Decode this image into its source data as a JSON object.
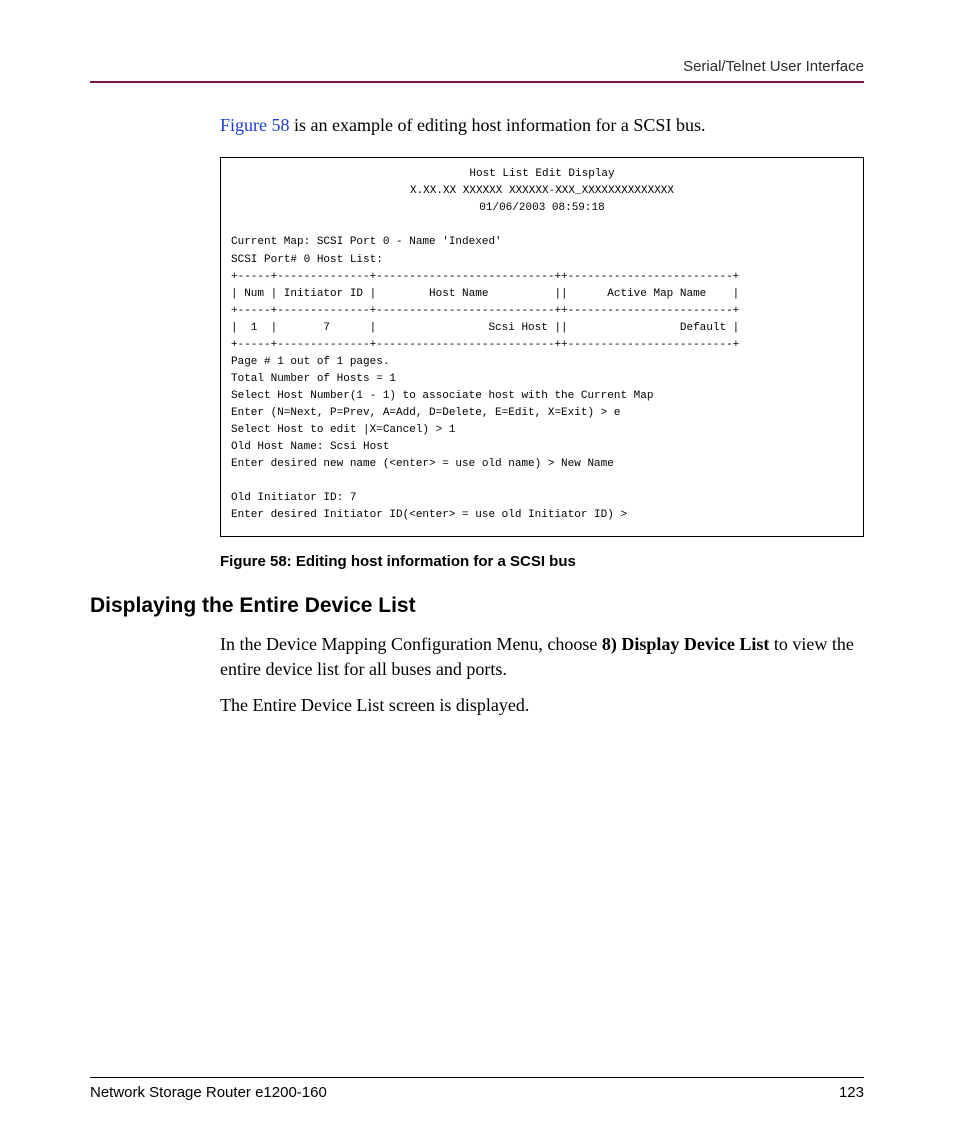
{
  "header": {
    "running": "Serial/Telnet User Interface"
  },
  "intro": {
    "link_text": "Figure 58",
    "rest": " is an example of editing host information for a SCSI bus."
  },
  "console": {
    "title": "Host List Edit Display",
    "version": "X.XX.XX XXXXXX XXXXXX-XXX_XXXXXXXXXXXXXX",
    "timestamp": "01/06/2003 08:59:18",
    "current_map": "Current Map: SCSI Port 0 - Name 'Indexed'",
    "port_line": "SCSI Port# 0 Host List:",
    "sep_a": "+-----+--------------+---------------------------++-------------------------+",
    "header_row": "| Num | Initiator ID |        Host Name          ||      Active Map Name    |",
    "sep_b": "+-----+--------------+---------------------------++-------------------------+",
    "data_row": "|  1  |       7      |                 Scsi Host ||                 Default |",
    "sep_c": "+-----+--------------+---------------------------++-------------------------+",
    "page_line": "Page # 1 out of 1 pages.",
    "total_line": "Total Number of Hosts = 1",
    "select_hostnum": "Select Host Number(1 - 1) to associate host with the Current Map",
    "enter_line": "Enter (N=Next, P=Prev, A=Add, D=Delete, E=Edit, X=Exit) > e",
    "select_edit": "Select Host to edit |X=Cancel) > 1",
    "old_name": "Old Host Name: Scsi Host",
    "new_name_prompt": "Enter desired new name (<enter> = use old name) > New Name",
    "old_id": "Old Initiator ID: 7",
    "new_id_prompt": "Enter desired Initiator ID(<enter> = use old Initiator ID) >"
  },
  "figure_caption": "Figure 58:  Editing host information for a SCSI bus",
  "section_heading": "Displaying the Entire Device List",
  "para1_a": "In the Device Mapping Configuration Menu, choose ",
  "para1_bold": "8) Display Device List",
  "para1_b": " to view the entire device list for all buses and ports.",
  "para2": "The Entire Device List screen is displayed.",
  "footer": {
    "doc": "Network Storage Router e1200-160",
    "page": "123"
  }
}
